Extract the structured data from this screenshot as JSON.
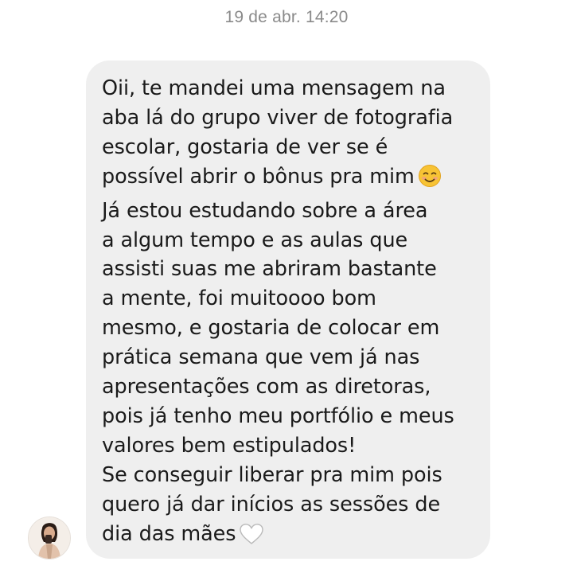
{
  "timestamp": "19 de abr. 14:20",
  "message": {
    "lines": [
      "Oii, te mandei uma mensagem na",
      "aba lá do grupo viver de fotografia",
      "escolar, gostaria de ver se é",
      "possível abrir o bônus pra mim",
      "Já estou estudando sobre a área",
      "a algum tempo e as aulas que",
      "assisti suas me abriram bastante",
      "a mente, foi muitoooo bom",
      "mesmo, e gostaria de colocar em",
      "prática semana que vem já nas",
      "apresentações com as diretoras,",
      "pois já tenho meu portfólio e meus",
      "valores bem estipulados!",
      "Se conseguir liberar pra mim pois",
      "quero já dar inícios as sessões de",
      "dia das mães"
    ],
    "emoji_after_line_4": "smiling-face-emoji",
    "emoji_after_line_16": "white-heart-emoji"
  },
  "sender": {
    "avatar_icon": "profile-avatar"
  }
}
